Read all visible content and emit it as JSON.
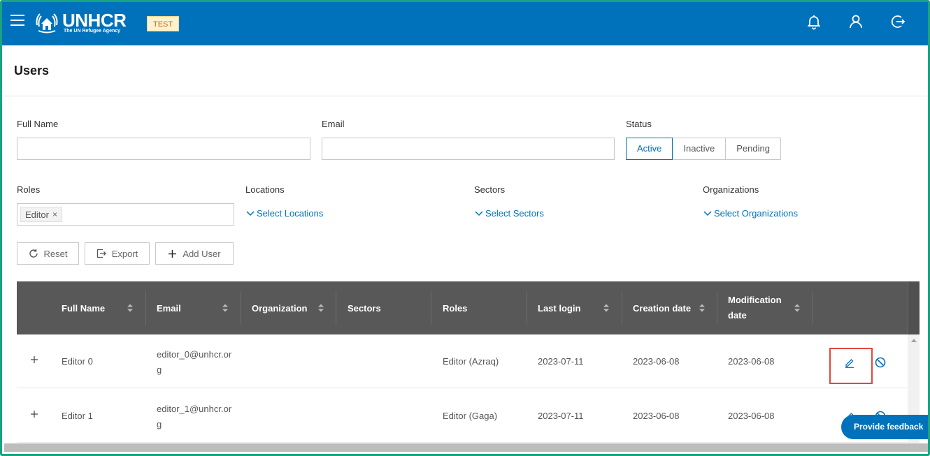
{
  "header": {
    "logo_text": "UNHCR",
    "logo_subtitle": "The UN Refugee Agency",
    "env_badge": "TEST",
    "icons": [
      "menu-icon",
      "bell-icon",
      "user-icon",
      "logout-icon"
    ]
  },
  "page": {
    "title": "Users"
  },
  "filters": {
    "full_name": {
      "label": "Full Name",
      "value": "",
      "placeholder": ""
    },
    "email": {
      "label": "Email",
      "value": "",
      "placeholder": ""
    },
    "status": {
      "label": "Status",
      "options": [
        "Active",
        "Inactive",
        "Pending"
      ],
      "selected": "Active"
    },
    "roles": {
      "label": "Roles",
      "selected_tags": [
        "Editor"
      ]
    },
    "locations": {
      "label": "Locations",
      "select_text": "Select Locations"
    },
    "sectors": {
      "label": "Sectors",
      "select_text": "Select Sectors"
    },
    "organizations": {
      "label": "Organizations",
      "select_text": "Select Organizations"
    }
  },
  "actions": {
    "reset": "Reset",
    "export": "Export",
    "add_user": "Add User"
  },
  "table": {
    "columns": [
      "Full Name",
      "Email",
      "Organization",
      "Sectors",
      "Roles",
      "Last login",
      "Creation date",
      "Modification date"
    ],
    "rows": [
      {
        "full_name": "Editor 0",
        "email": "editor_0@unhcr.org",
        "organization": "",
        "sectors": "",
        "roles": "Editor (Azraq)",
        "last_login": "2023-07-11",
        "creation_date": "2023-06-08",
        "modification_date": "2023-06-08"
      },
      {
        "full_name": "Editor 1",
        "email": "editor_1@unhcr.org",
        "organization": "",
        "sectors": "",
        "roles": "Editor (Gaga)",
        "last_login": "2023-07-11",
        "creation_date": "2023-06-08",
        "modification_date": "2023-06-08"
      }
    ]
  },
  "feedback": {
    "label": "Provide feedback"
  },
  "colors": {
    "brand": "#0072bc",
    "table_header": "#585858",
    "badge_bg": "#fdf2d0",
    "badge_text": "#d0671b",
    "highlight": "#e0483c",
    "frame": "#1aa381"
  }
}
